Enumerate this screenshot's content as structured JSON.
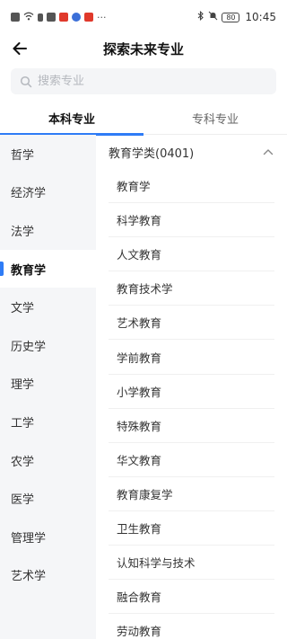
{
  "status_bar": {
    "dots": "···",
    "battery": "80",
    "time": "10:45"
  },
  "header": {
    "title": "探索未来专业"
  },
  "search": {
    "placeholder": "搜索专业"
  },
  "tabs": [
    {
      "label": "本科专业",
      "active": true
    },
    {
      "label": "专科专业",
      "active": false
    }
  ],
  "sidebar": {
    "items": [
      {
        "label": "哲学"
      },
      {
        "label": "经济学"
      },
      {
        "label": "法学"
      },
      {
        "label": "教育学"
      },
      {
        "label": "文学"
      },
      {
        "label": "历史学"
      },
      {
        "label": "理学"
      },
      {
        "label": "工学"
      },
      {
        "label": "农学"
      },
      {
        "label": "医学"
      },
      {
        "label": "管理学"
      },
      {
        "label": "艺术学"
      }
    ],
    "selected": "教育学"
  },
  "content": {
    "group_title": "教育学类(0401)",
    "majors": [
      "教育学",
      "科学教育",
      "人文教育",
      "教育技术学",
      "艺术教育",
      "学前教育",
      "小学教育",
      "特殊教育",
      "华文教育",
      "教育康复学",
      "卫生教育",
      "认知科学与技术",
      "融合教育",
      "劳动教育"
    ]
  },
  "colors": {
    "accent": "#2f7cf6",
    "sidebar_bg": "#f5f6f8"
  },
  "icons": [
    "back-arrow-icon",
    "search-icon",
    "chevron-up-icon"
  ]
}
